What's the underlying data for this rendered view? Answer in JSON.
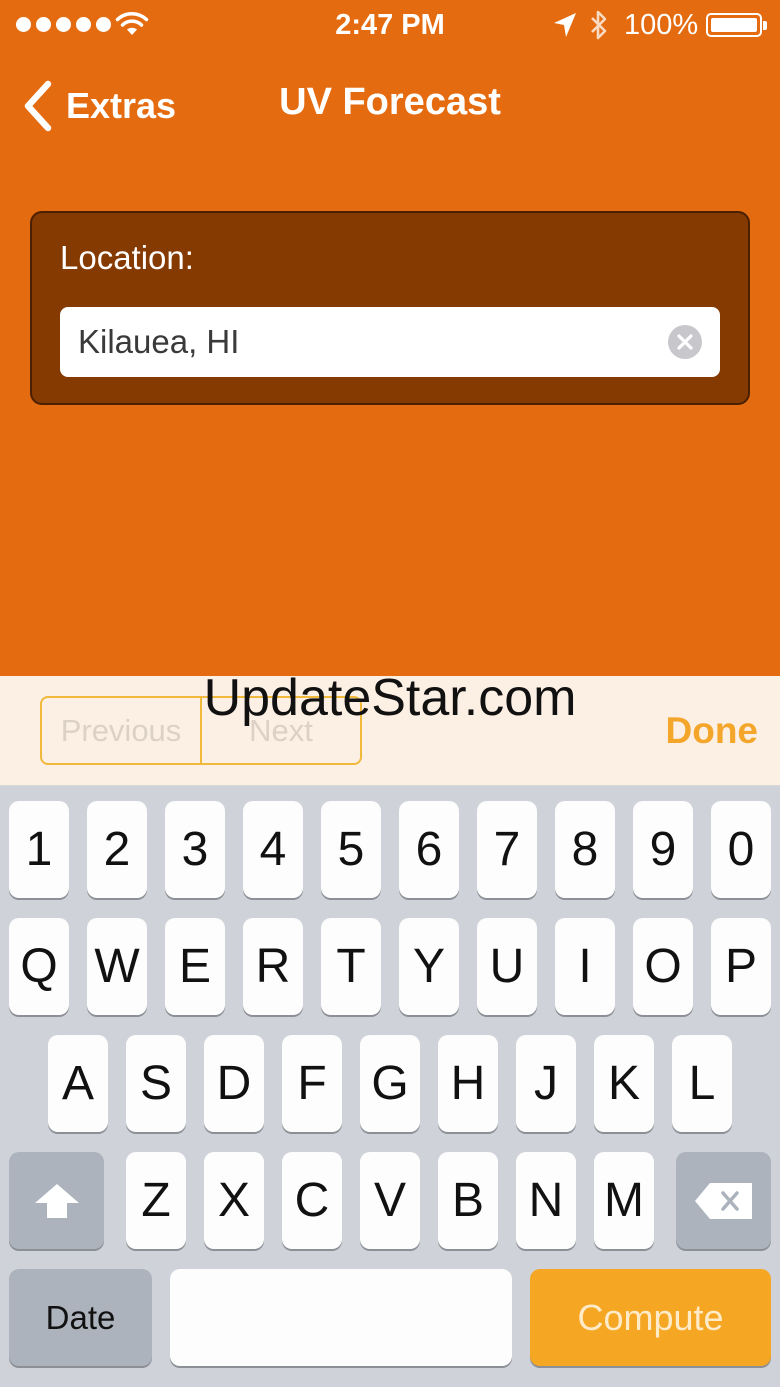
{
  "status_bar": {
    "time": "2:47 PM",
    "battery_percent": "100%",
    "signal_dots": 5,
    "icons": [
      "signal-icon",
      "wifi-icon",
      "location-arrow-icon",
      "bluetooth-icon",
      "battery-icon"
    ]
  },
  "nav": {
    "back_label": "Extras",
    "title": "UV Forecast"
  },
  "location": {
    "label": "Location:",
    "value": "Kilauea, HI"
  },
  "toolbar": {
    "previous_label": "Previous",
    "next_label": "Next",
    "done_label": "Done",
    "watermark": "UpdateStar.com"
  },
  "keyboard": {
    "row1": [
      "1",
      "2",
      "3",
      "4",
      "5",
      "6",
      "7",
      "8",
      "9",
      "0"
    ],
    "row2": [
      "Q",
      "W",
      "E",
      "R",
      "T",
      "Y",
      "U",
      "I",
      "O",
      "P"
    ],
    "row3": [
      "A",
      "S",
      "D",
      "F",
      "G",
      "H",
      "J",
      "K",
      "L"
    ],
    "row4": [
      "Z",
      "X",
      "C",
      "V",
      "B",
      "N",
      "M"
    ],
    "date_label": "Date",
    "compute_label": "Compute"
  },
  "colors": {
    "accent": "#E56B10",
    "card": "#853A02",
    "done": "#F3A62A",
    "compute_key": "#F5A623"
  }
}
